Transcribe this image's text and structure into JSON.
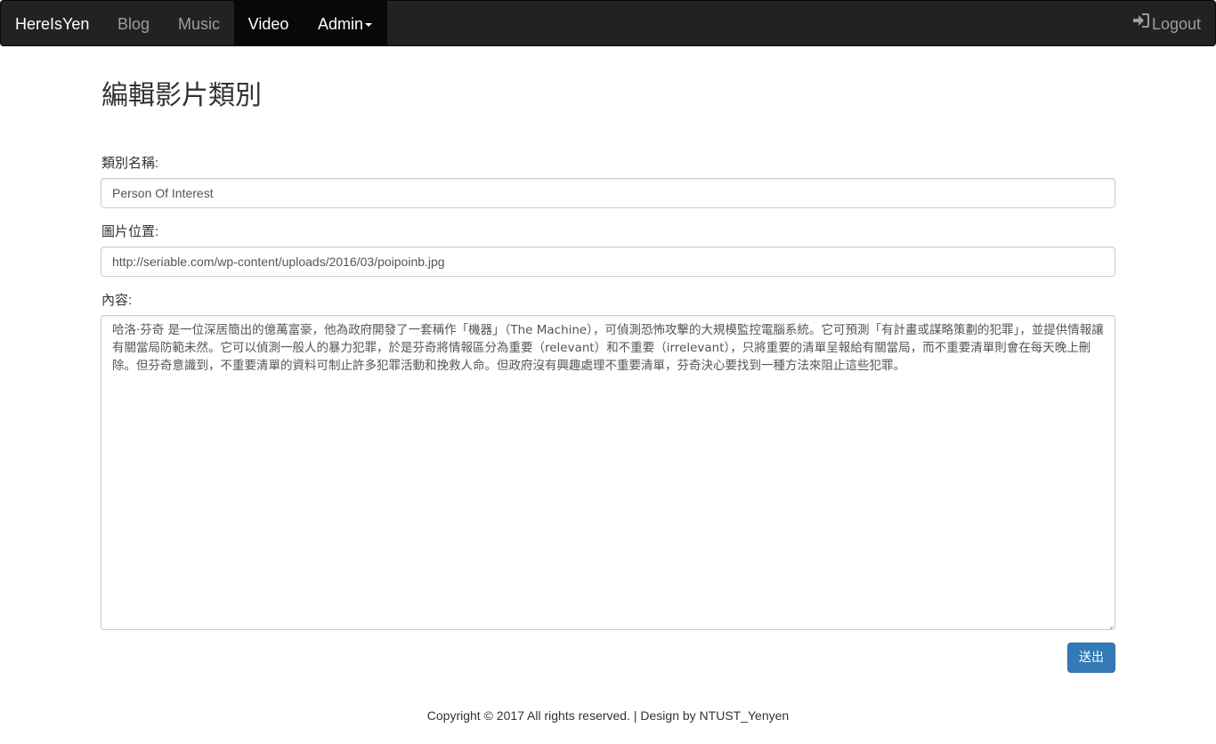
{
  "navbar": {
    "brand": "HereIsYen",
    "items": [
      {
        "label": "Blog",
        "active": false
      },
      {
        "label": "Music",
        "active": false
      },
      {
        "label": "Video",
        "active": true
      },
      {
        "label": "Admin",
        "active": true,
        "dropdown": true
      }
    ],
    "logout": {
      "label": "Logout",
      "icon": "log-in-icon"
    }
  },
  "page": {
    "title": "編輯影片類別"
  },
  "form": {
    "name_label": "類別名稱:",
    "name_value": "Person Of Interest",
    "image_label": "圖片位置:",
    "image_value": "http://seriable.com/wp-content/uploads/2016/03/poipoinb.jpg",
    "content_label": "內容:",
    "content_value": "哈洛·芬奇 是一位深居簡出的億萬富豪，他為政府開發了一套稱作「機器」（The Machine），可偵測恐怖攻擊的大規模監控電腦系統。它可預測「有計畫或謀略策劃的犯罪」，並提供情報讓有關當局防範未然。它可以偵測一般人的暴力犯罪，於是芬奇將情報區分為重要（relevant）和不重要（irrelevant），只將重要的清單呈報給有關當局，而不重要清單則會在每天晚上刪除。但芬奇意識到，不重要清單的資料可制止許多犯罪活動和挽救人命。但政府沒有興趣處理不重要清單，芬奇決心要找到一種方法來阻止這些犯罪。",
    "submit_label": "送出"
  },
  "footer": {
    "text": "Copyright © 2017 All rights reserved. | Design by NTUST_Yenyen"
  },
  "colors": {
    "navbar_bg": "#222222",
    "navbar_active_bg": "#080808",
    "primary_button": "#337ab7"
  }
}
